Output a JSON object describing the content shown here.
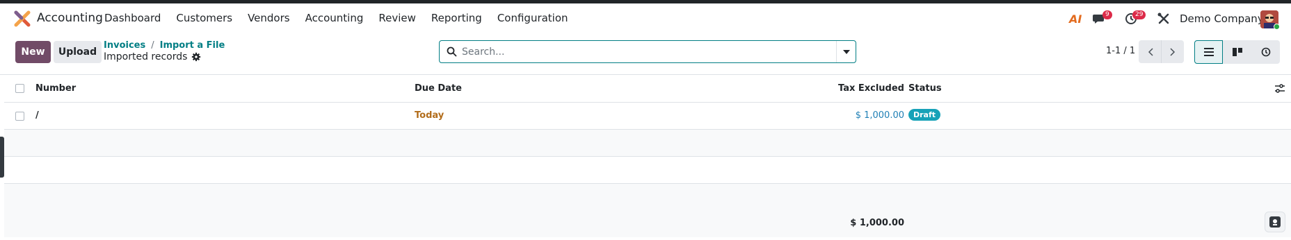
{
  "navbar": {
    "app_name": "Accounting",
    "menu": [
      "Dashboard",
      "Customers",
      "Vendors",
      "Accounting",
      "Review",
      "Reporting",
      "Configuration"
    ],
    "ai_label": "AI",
    "messages_count": "9",
    "activities_count": "29",
    "company": "Demo Company"
  },
  "control": {
    "new_label": "New",
    "upload_label": "Upload",
    "breadcrumb": [
      "Invoices",
      "Import a File"
    ],
    "breadcrumb_sep": "/",
    "current": "Imported records",
    "search_placeholder": "Search...",
    "pager": "1-1 / 1"
  },
  "table": {
    "columns": {
      "number": "Number",
      "due_date": "Due Date",
      "tax_excluded": "Tax Excluded",
      "status": "Status"
    },
    "rows": [
      {
        "number": "/",
        "due_date": "Today",
        "tax_excluded": "$ 1,000.00",
        "status": "Draft"
      }
    ],
    "total_tax_excluded": "$ 1,000.00"
  },
  "colors": {
    "brand": "#714b67",
    "link": "#017e84",
    "due_today": "#b26d1b",
    "amount": "#1f7fb5",
    "draft_badge": "#17a2b8",
    "badge_red": "#dc2a48"
  }
}
